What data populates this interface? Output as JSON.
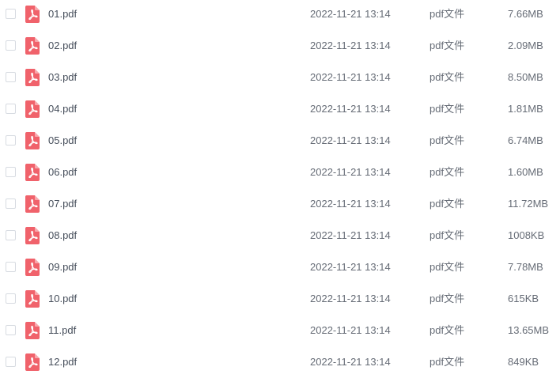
{
  "icon": "pdf-file-icon",
  "colors": {
    "pdf_icon": "#f0626b",
    "text": "#454d5a",
    "muted_text": "#666c76",
    "checkbox_border": "#d7dbe1"
  },
  "files": [
    {
      "name": "01.pdf",
      "date": "2022-11-21 13:14",
      "type": "pdf文件",
      "size": "7.66MB"
    },
    {
      "name": "02.pdf",
      "date": "2022-11-21 13:14",
      "type": "pdf文件",
      "size": "2.09MB"
    },
    {
      "name": "03.pdf",
      "date": "2022-11-21 13:14",
      "type": "pdf文件",
      "size": "8.50MB"
    },
    {
      "name": "04.pdf",
      "date": "2022-11-21 13:14",
      "type": "pdf文件",
      "size": "1.81MB"
    },
    {
      "name": "05.pdf",
      "date": "2022-11-21 13:14",
      "type": "pdf文件",
      "size": "6.74MB"
    },
    {
      "name": "06.pdf",
      "date": "2022-11-21 13:14",
      "type": "pdf文件",
      "size": "1.60MB"
    },
    {
      "name": "07.pdf",
      "date": "2022-11-21 13:14",
      "type": "pdf文件",
      "size": "11.72MB"
    },
    {
      "name": "08.pdf",
      "date": "2022-11-21 13:14",
      "type": "pdf文件",
      "size": "1008KB"
    },
    {
      "name": "09.pdf",
      "date": "2022-11-21 13:14",
      "type": "pdf文件",
      "size": "7.78MB"
    },
    {
      "name": "10.pdf",
      "date": "2022-11-21 13:14",
      "type": "pdf文件",
      "size": "615KB"
    },
    {
      "name": "11.pdf",
      "date": "2022-11-21 13:14",
      "type": "pdf文件",
      "size": "13.65MB"
    },
    {
      "name": "12.pdf",
      "date": "2022-11-21 13:14",
      "type": "pdf文件",
      "size": "849KB"
    }
  ]
}
